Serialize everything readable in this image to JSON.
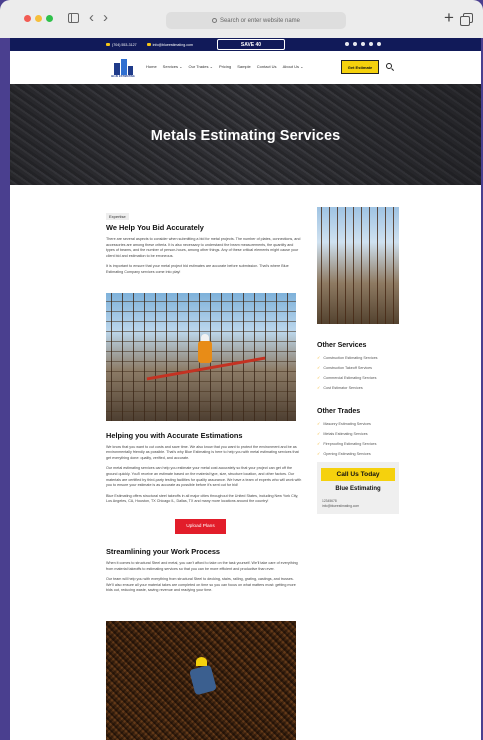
{
  "browser": {
    "address_placeholder": "Search or enter website name"
  },
  "topbar": {
    "phone": "(704) 553-3127",
    "email": "info@blueestimating.com",
    "promo_label": "SAVE 40"
  },
  "nav": {
    "logo_text": "BLUE ESTIMATING",
    "items": [
      "Home",
      "Services ⌄",
      "Our Trades ⌄",
      "Pricing",
      "Sample",
      "Contact Us",
      "About Us ⌄"
    ],
    "cta_label": "Get Estimate"
  },
  "hero": {
    "title": "Metals Estimating Services"
  },
  "main": {
    "tag": "Expertise",
    "section1_title": "We Help You Bid Accurately",
    "section1_p1": "There are several aspects to consider when submitting a bid for metal projects. The number of plates, connections, and accessories are among these criteria. It is also necessary to understand the beam measurements, the quantity and types of beams, and the number of person-hours, among other things. Any of these critical elements might cause your client bid and estimation to be erroneous.",
    "section1_p2": "It is important to ensure that your metal project bid estimates are accurate before submission. That's where Blue Estimating Company services come into play!",
    "section2_title": "Helping you with Accurate Estimations",
    "section2_p1": "We know that you want to cut costs and save time. We also know that you want to protect the environment and be as environmentally friendly as possible. That's why Blue Estimating is here to help you with metal estimating services that get everything done: quality, verified, and accurate.",
    "section2_p2": "Our metal estimating services can help you estimate your metal cost accurately so that your project can get off the ground quickly. You'll receive an estimate based on the material type, size, structure location, and other factors. Our materials are certified by third-party testing facilities for quality assurance. We have a team of experts who will work with you to ensure your estimate is as accurate as possible before it's sent out for bid!",
    "section2_p3": "Blue Estimating offers structural steel takeoffs in all major cities throughout the United States, including New York City, Los Angeles, CA, Houston, TX Chicago IL, Dallas, TX and many more locations around the country!",
    "upload_label": "Upload Plans",
    "section3_title": "Streamlining your Work Process",
    "section3_p1": "When it comes to structural Steel and metal, you can't afford to take on the task yourself. We'll take care of everything from material takeoffs to estimating services so that you can be more efficient and productive than ever.",
    "section3_p2": "Our team will help you with everything from structural Steel to decking, stairs, railing, grating, castings, and trusses. We'll also ensure all your material takes are completed on time so you can focus on what matters most: getting more bids out, reducing waste, saving revenue and readying your time."
  },
  "sidebar": {
    "services_title": "Other Services",
    "services": [
      "Construction Estimating Services",
      "Construction Takeoff Services",
      "Commercial Estimating Services",
      "Cost Estimator Services"
    ],
    "trades_title": "Other Trades",
    "trades": [
      "Masonry Estimating Services",
      "Metals Estimating Services",
      "Fireproofing Estimating Services",
      "Opening Estimating Services"
    ],
    "call_label": "Call Us Today",
    "company": "Blue Estimating",
    "phone": "12345678",
    "email": "info@blueestimating.com"
  },
  "colors": {
    "topbar": "#111a59",
    "accent_yellow": "#f5d10d",
    "upload_red": "#e21d2a",
    "check_color": "#f2b01e"
  }
}
